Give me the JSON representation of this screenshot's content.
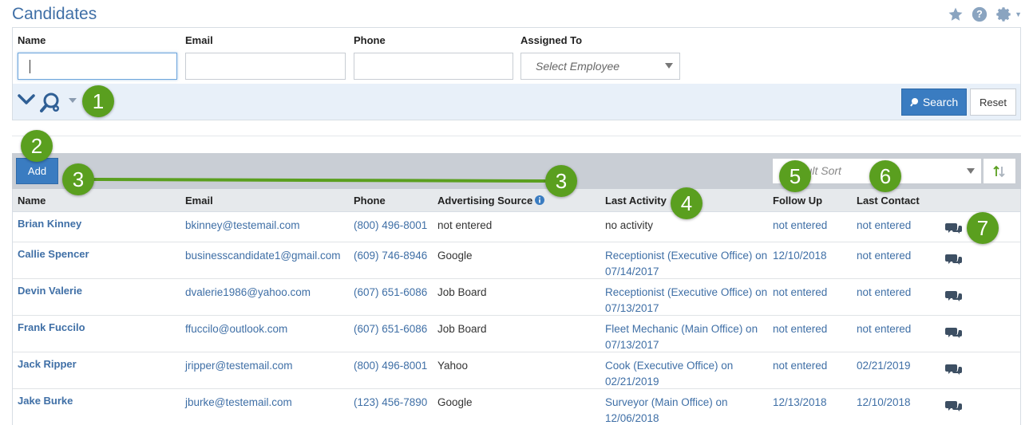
{
  "page": {
    "title": "Candidates"
  },
  "colors": {
    "accent": "#3a7cc1",
    "link": "#3f6fa6",
    "annotation": "#5a9f1f"
  },
  "top_icons": [
    "star-icon",
    "help-icon",
    "gear-icon"
  ],
  "search": {
    "name_label": "Name",
    "name_value": "",
    "email_label": "Email",
    "email_value": "",
    "phone_label": "Phone",
    "phone_value": "",
    "assigned_label": "Assigned To",
    "assigned_placeholder": "Select Employee",
    "search_button": "Search",
    "reset_button": "Reset"
  },
  "toolbar": {
    "add_button": "Add",
    "sort_placeholder": "Default Sort"
  },
  "table": {
    "columns": [
      "Name",
      "Email",
      "Phone",
      "Advertising Source",
      "Last Activity",
      "Follow Up",
      "Last Contact"
    ],
    "rows": [
      {
        "name": "Brian Kinney",
        "email": "bkinney@testemail.com",
        "phone": "(800) 496-8001",
        "source": "not entered",
        "activity": "no activity",
        "follow_up": "not entered",
        "last_contact": "not entered"
      },
      {
        "name": "Callie Spencer",
        "email": "businesscandidate1@gmail.com",
        "phone": "(609) 746-8946",
        "source": "Google",
        "activity": "Receptionist (Executive Office) on 07/14/2017",
        "follow_up": "12/10/2018",
        "last_contact": "not entered"
      },
      {
        "name": "Devin Valerie",
        "email": "dvalerie1986@yahoo.com",
        "phone": "(607) 651-6086",
        "source": "Job Board",
        "activity": "Receptionist (Executive Office) on 07/13/2017",
        "follow_up": "not entered",
        "last_contact": "not entered"
      },
      {
        "name": "Frank Fuccilo",
        "email": "ffuccilo@outlook.com",
        "phone": "(607) 651-6086",
        "source": "Job Board",
        "activity": "Fleet Mechanic (Main Office) on 07/13/2017",
        "follow_up": "not entered",
        "last_contact": "not entered"
      },
      {
        "name": "Jack Ripper",
        "email": "jripper@testemail.com",
        "phone": "(800) 496-8001",
        "source": "Yahoo",
        "activity": "Cook (Executive Office) on 02/21/2019",
        "follow_up": "not entered",
        "last_contact": "02/21/2019"
      },
      {
        "name": "Jake Burke",
        "email": "jburke@testemail.com",
        "phone": "(123) 456-7890",
        "source": "Google",
        "activity": "Surveyor (Main Office) on 12/06/2018",
        "follow_up": "12/13/2018",
        "last_contact": "12/10/2018"
      }
    ]
  },
  "annotations": [
    "1",
    "2",
    "3",
    "3",
    "4",
    "5",
    "6",
    "7"
  ]
}
